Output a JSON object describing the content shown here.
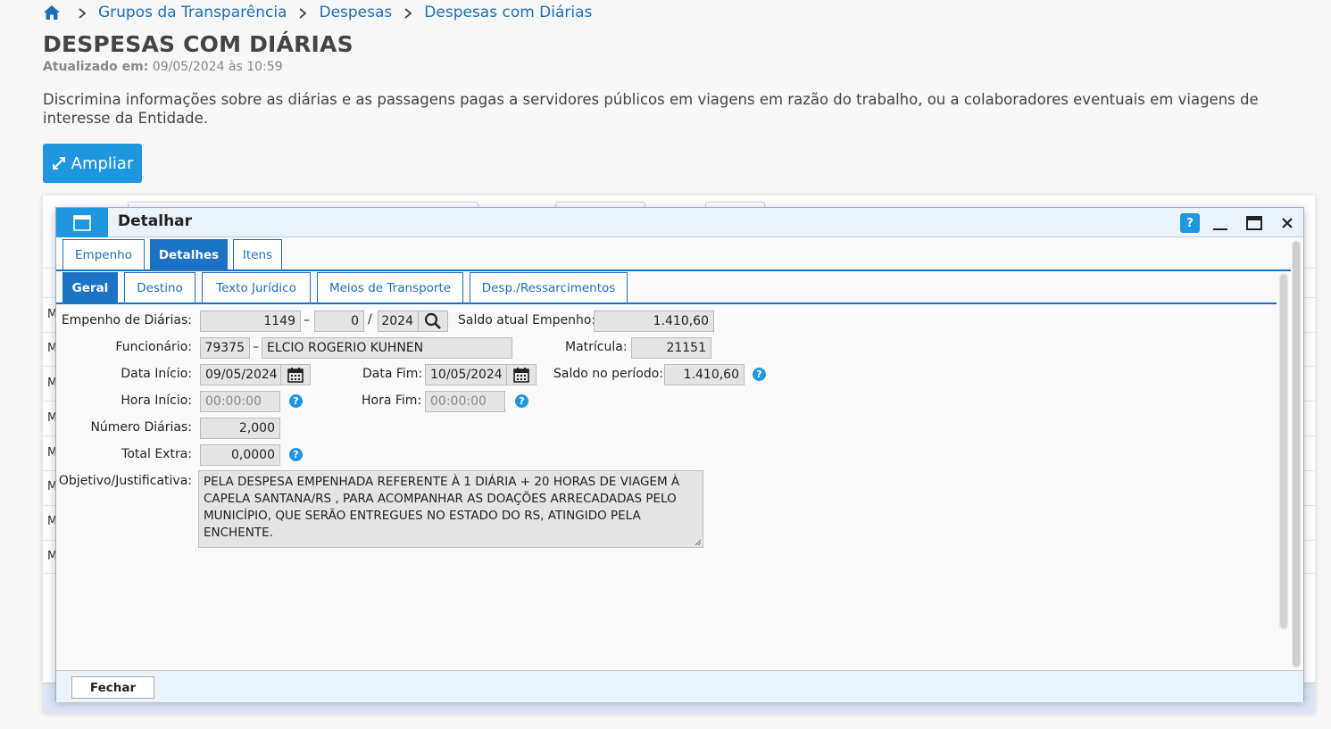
{
  "breadcrumb": {
    "items": [
      "Grupos da Transparência",
      "Despesas",
      "Despesas com Diárias"
    ]
  },
  "page": {
    "title": "DESPESAS COM DIÁRIAS",
    "updated_label": "Atualizado em:",
    "updated_value": "09/05/2024 às 10:59",
    "description": "Discrimina informações sobre as diárias e as passagens pagas a servidores públicos em viagens em razão do trabalho, ou a colaboradores eventuais em viagens de interesse da Entidade.",
    "expand_label": "Ampliar"
  },
  "background_grid": {
    "row_letters": [
      "M",
      "M",
      "M",
      "M",
      "M",
      "M",
      "M",
      "M"
    ]
  },
  "modal": {
    "title": "Detalhar",
    "help_label": "?",
    "tabs": [
      "Empenho",
      "Detalhes",
      "Itens"
    ],
    "active_tab": "Detalhes",
    "subtabs": [
      "Geral",
      "Destino",
      "Texto Jurídico",
      "Meios de Transporte",
      "Desp./Ressarcimentos"
    ],
    "active_subtab": "Geral",
    "close_label": "Fechar"
  },
  "form": {
    "empenho_label": "Empenho de Diárias:",
    "empenho_number": "1149",
    "empenho_seq": "0",
    "empenho_year": "2024",
    "saldo_atual_label": "Saldo atual Empenho:",
    "saldo_atual_value": "1.410,60",
    "funcionario_label": "Funcionário:",
    "funcionario_code": "79375",
    "funcionario_name": "ELCIO ROGERIO KUHNEN",
    "matricula_label": "Matrícula:",
    "matricula_value": "21151",
    "data_inicio_label": "Data Início:",
    "data_inicio_value": "09/05/2024",
    "data_fim_label": "Data Fim:",
    "data_fim_value": "10/05/2024",
    "saldo_periodo_label": "Saldo no período:",
    "saldo_periodo_value": "1.410,60",
    "hora_inicio_label": "Hora Início:",
    "hora_inicio_placeholder": "00:00:00",
    "hora_fim_label": "Hora Fim:",
    "hora_fim_placeholder": "00:00:00",
    "numero_diarias_label": "Número Diárias:",
    "numero_diarias_value": "2,000",
    "total_extra_label": "Total Extra:",
    "total_extra_value": "0,0000",
    "objetivo_label": "Objetivo/Justificativa:",
    "objetivo_value": "PELA DESPESA EMPENHADA REFERENTE À 1 DIÁRIA + 20 HORAS DE  VIAGEM À CAPELA SANTANA/RS ,  PARA  ACOMPANHAR AS DOAÇÕES ARRECADADAS PELO MUNICÍPIO, QUE SERÃO ENTREGUES NO ESTADO DO RS, ATINGIDO PELA ENCHENTE.",
    "dash": "–",
    "slash": "/",
    "info": "?"
  },
  "colors": {
    "primary": "#1e96e0",
    "tab_active": "#1c72c4",
    "link": "#1c6fb4",
    "field_bg": "#e4e4e4"
  }
}
